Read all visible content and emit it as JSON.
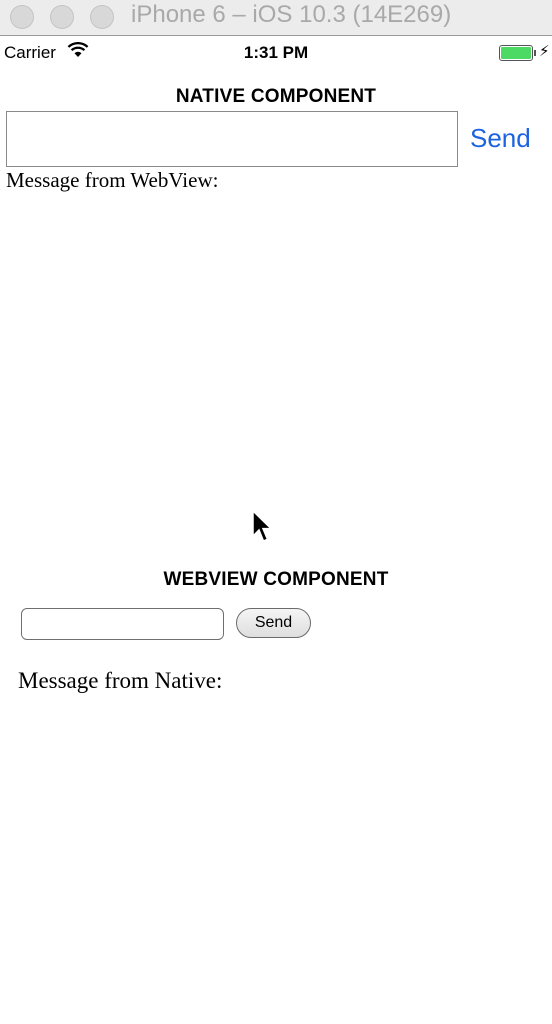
{
  "window": {
    "title": "iPhone 6 – iOS 10.3 (14E269)"
  },
  "status_bar": {
    "carrier": "Carrier",
    "time": "1:31 PM",
    "battery_color": "#4cd964"
  },
  "native": {
    "heading": "NATIVE COMPONENT",
    "input_value": "",
    "send_label": "Send",
    "message_label": "Message from WebView:"
  },
  "webview": {
    "heading": "WEBVIEW COMPONENT",
    "input_value": "",
    "send_label": "Send",
    "message_label": "Message from Native:"
  },
  "colors": {
    "ios_link_blue": "#1d63e0"
  }
}
